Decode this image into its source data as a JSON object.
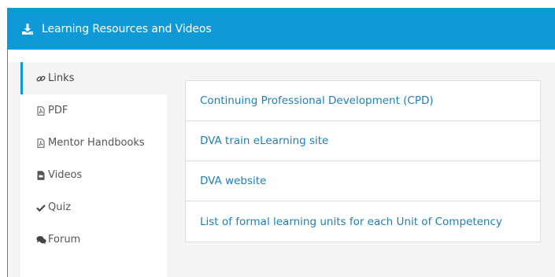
{
  "header": {
    "title": "Learning Resources and Videos",
    "icon": "download-icon"
  },
  "sidebar": {
    "items": [
      {
        "label": "Links",
        "icon": "link-icon",
        "active": true
      },
      {
        "label": "PDF",
        "icon": "pdf-file-icon",
        "active": false
      },
      {
        "label": "Mentor Handbooks",
        "icon": "pdf-file-icon",
        "active": false
      },
      {
        "label": "Videos",
        "icon": "video-file-icon",
        "active": false
      },
      {
        "label": "Quiz",
        "icon": "checkmark-icon",
        "active": false
      },
      {
        "label": "Forum",
        "icon": "comments-icon",
        "active": false
      }
    ]
  },
  "links": [
    {
      "label": "Continuing Professional Development (CPD)"
    },
    {
      "label": "DVA train eLearning site"
    },
    {
      "label": "DVA website"
    },
    {
      "label": "List of formal learning units for each Unit of Competency"
    }
  ],
  "colors": {
    "accent": "#0f9ad7",
    "link": "#1d7fb9",
    "text": "#555555"
  }
}
